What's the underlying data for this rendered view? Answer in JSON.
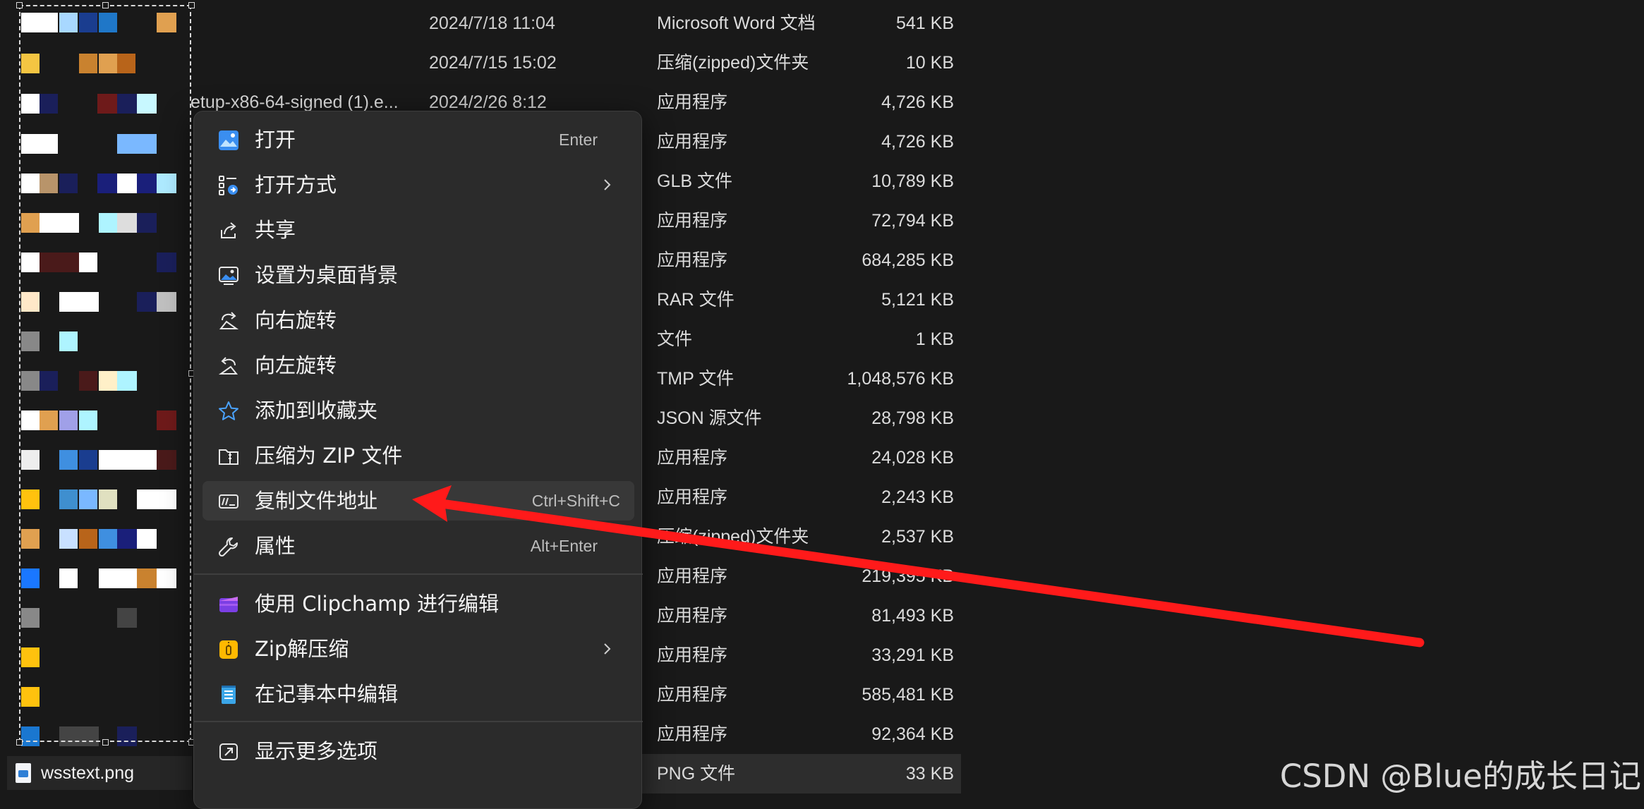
{
  "files": [
    {
      "date": "2024/7/18 11:04",
      "type": "Microsoft Word 文档",
      "size": "541 KB"
    },
    {
      "date": "2024/7/15 15:02",
      "type": "压缩(zipped)文件夹",
      "size": "10 KB"
    },
    {
      "name_partial": "etup-x86-64-signed (1).e...",
      "date": "2024/2/26 8:12",
      "type": "应用程序",
      "size": "4,726 KB"
    },
    {
      "date": "",
      "type": "应用程序",
      "size": "4,726 KB"
    },
    {
      "date": "",
      "type": "GLB 文件",
      "size": "10,789 KB"
    },
    {
      "date": "",
      "type": "应用程序",
      "size": "72,794 KB"
    },
    {
      "date": "",
      "type": "应用程序",
      "size": "684,285 KB"
    },
    {
      "date": "",
      "type": "RAR 文件",
      "size": "5,121 KB"
    },
    {
      "date": "",
      "type": "文件",
      "size": "1 KB"
    },
    {
      "date": "",
      "type": "TMP 文件",
      "size": "1,048,576 KB"
    },
    {
      "date": "",
      "type": "JSON 源文件",
      "size": "28,798 KB"
    },
    {
      "date": "",
      "type": "应用程序",
      "size": "24,028 KB"
    },
    {
      "date": "",
      "type": "应用程序",
      "size": "2,243 KB"
    },
    {
      "date": "",
      "type": "压缩(zipped)文件夹",
      "size": "2,537 KB"
    },
    {
      "date": "",
      "type": "应用程序",
      "size": "219,395 KB"
    },
    {
      "date": "",
      "type": "应用程序",
      "size": "81,493 KB"
    },
    {
      "date": "",
      "type": "应用程序",
      "size": "33,291 KB"
    },
    {
      "date": "",
      "type": "应用程序",
      "size": "585,481 KB"
    },
    {
      "date": "",
      "type": "应用程序",
      "size": "92,364 KB"
    },
    {
      "date": "",
      "type": "PNG 文件",
      "size": "33 KB"
    }
  ],
  "selected_file": {
    "name": "wsstext.png"
  },
  "context_menu": {
    "items": [
      {
        "label": "打开",
        "shortcut": "Enter",
        "icon": "open-image-icon"
      },
      {
        "label": "打开方式",
        "icon": "open-with-icon",
        "submenu": true
      },
      {
        "label": "共享",
        "icon": "share-icon"
      },
      {
        "label": "设置为桌面背景",
        "icon": "wallpaper-icon"
      },
      {
        "label": "向右旋转",
        "icon": "rotate-right-icon"
      },
      {
        "label": "向左旋转",
        "icon": "rotate-left-icon"
      },
      {
        "label": "添加到收藏夹",
        "icon": "star-icon"
      },
      {
        "label": "压缩为 ZIP 文件",
        "icon": "zip-folder-icon"
      },
      {
        "label": "复制文件地址",
        "shortcut": "Ctrl+Shift+C",
        "icon": "copy-path-icon"
      },
      {
        "label": "属性",
        "shortcut": "Alt+Enter",
        "icon": "wrench-icon"
      },
      {
        "label": "使用 Clipchamp 进行编辑",
        "icon": "clipchamp-icon"
      },
      {
        "label": "Zip解压缩",
        "icon": "zip-extract-icon",
        "submenu": true
      },
      {
        "label": "在记事本中编辑",
        "icon": "notepad-icon"
      },
      {
        "label": "显示更多选项",
        "icon": "more-options-icon"
      }
    ]
  },
  "watermark": "CSDN @Blue的成长日记",
  "colors": {
    "accent": "#60cdff",
    "arrow": "#ff1a1a",
    "menu_bg": "#2b2b2b",
    "bg": "#191919"
  }
}
